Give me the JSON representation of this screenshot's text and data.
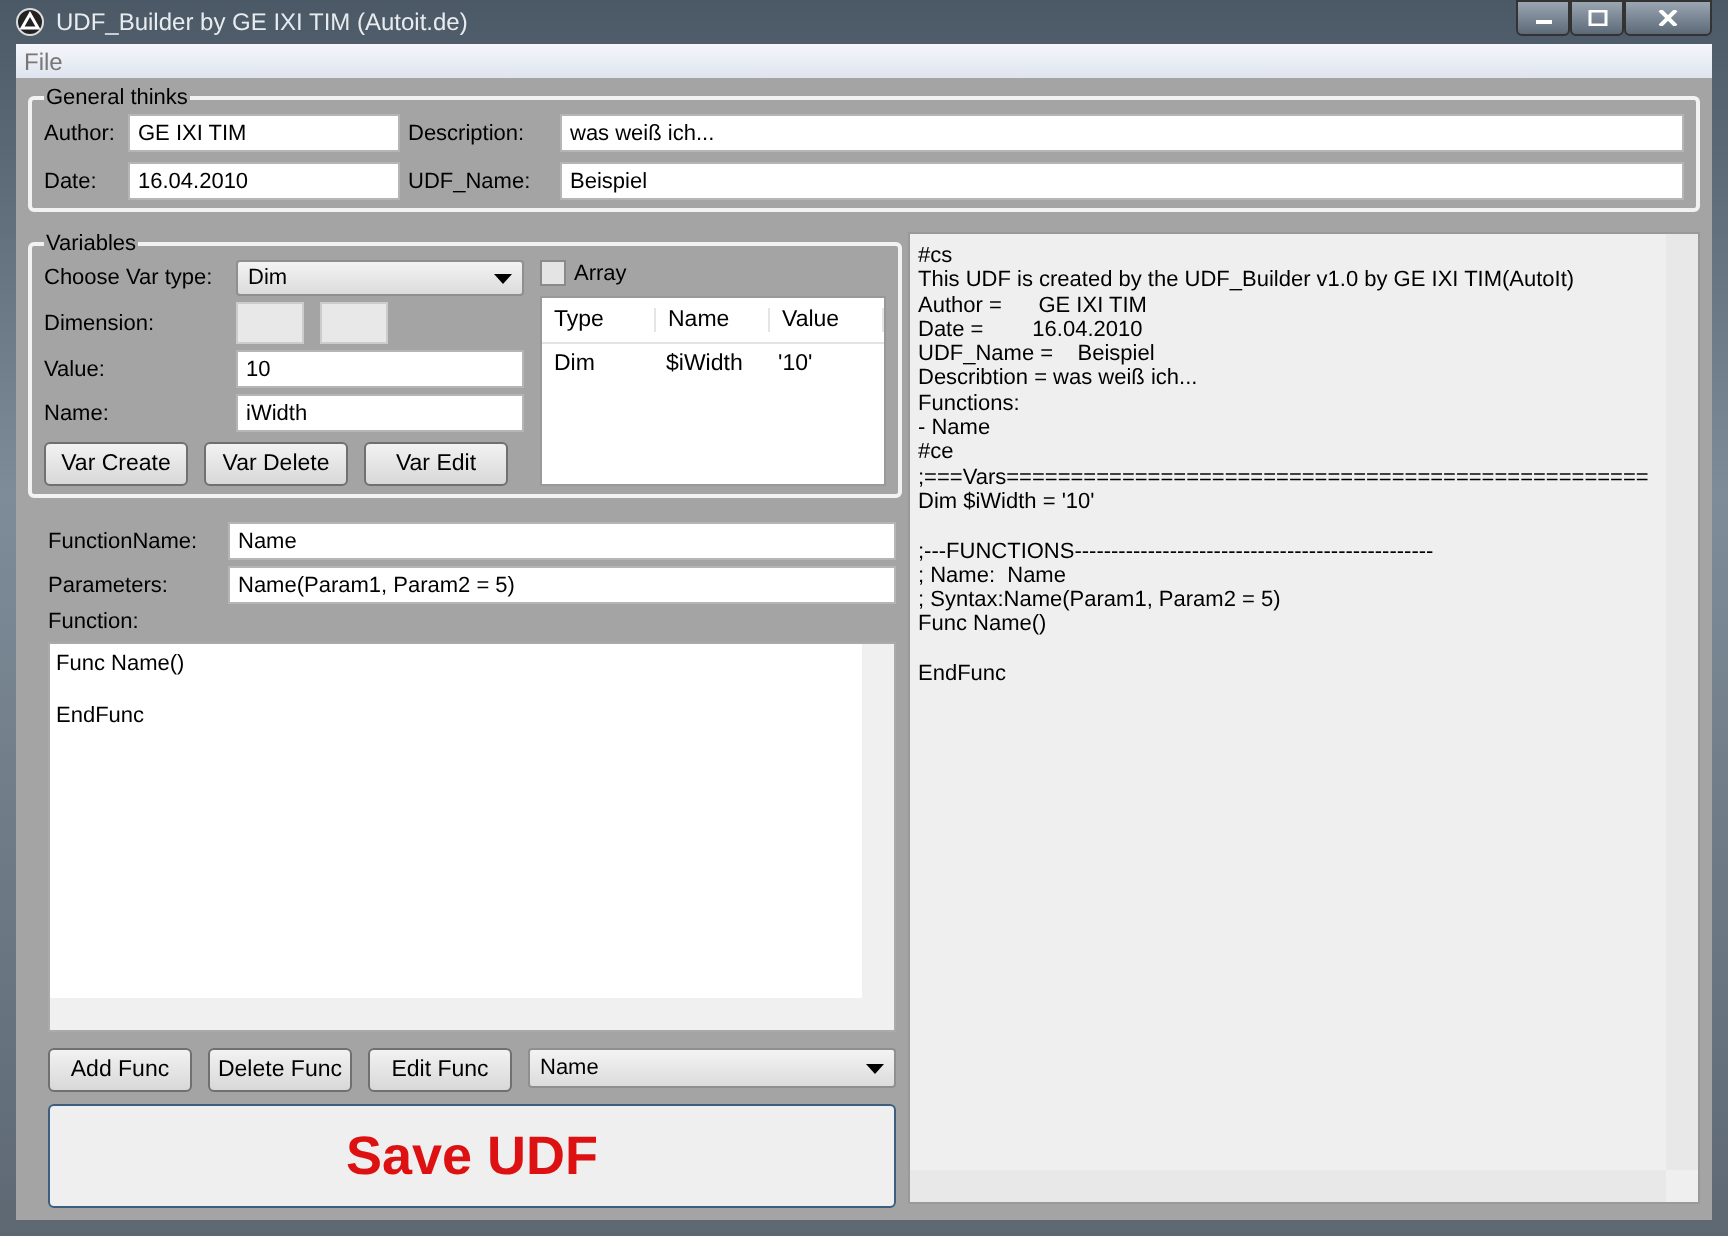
{
  "window": {
    "title": "UDF_Builder by GE IXI TIM (Autoit.de)"
  },
  "menu": [
    "File"
  ],
  "general": {
    "legend": "General thinks",
    "fields": [
      {
        "label": "Author:",
        "value": "GE IXI TIM"
      },
      {
        "label": "Description:",
        "value": "was weiß ich..."
      },
      {
        "label": "Date:",
        "value": "16.04.2010"
      },
      {
        "label": "UDF_Name:",
        "value": "Beispiel"
      }
    ]
  },
  "variables": {
    "legend": "Variables",
    "var_type": {
      "label": "Choose Var type:",
      "value": "Dim"
    },
    "array": {
      "label": "Array",
      "checked": false
    },
    "dimension": {
      "label": "Dimension:"
    },
    "value": {
      "label": "Value:",
      "value": "10"
    },
    "name": {
      "label": "Name:",
      "value": "iWidth"
    },
    "buttons": [
      "Var Create",
      "Var Delete",
      "Var Edit"
    ],
    "table": {
      "columns": [
        "Type",
        "Name",
        "Value"
      ],
      "rows": [
        [
          "Dim",
          "$iWidth",
          "'10'"
        ]
      ]
    }
  },
  "function": {
    "name": {
      "label": "FunctionName:",
      "value": "Name"
    },
    "parameters": {
      "label": "Parameters:",
      "value": "Name(Param1, Param2 = 5)"
    },
    "body_label": "Function:",
    "body": "Func Name()\n\nEndFunc",
    "buttons": [
      "Add Func",
      "Delete Func",
      "Edit Func"
    ],
    "select": "Name",
    "save": "Save UDF"
  },
  "output": "#cs\nThis UDF is created by the UDF_Builder v1.0 by GE IXI TIM(AutoIt)\nAuthor =      GE IXI TIM\nDate =        16.04.2010\nUDF_Name =    Beispiel\nDescribtion = was weiß ich...\nFunctions:\n- Name\n#ce\n;===Vars==================================================\nDim $iWidth = '10'\n\n;---FUNCTIONS-------------------------------------------------\n; Name:  Name\n; Syntax:Name(Param1, Param2 = 5)\nFunc Name()\n\nEndFunc"
}
